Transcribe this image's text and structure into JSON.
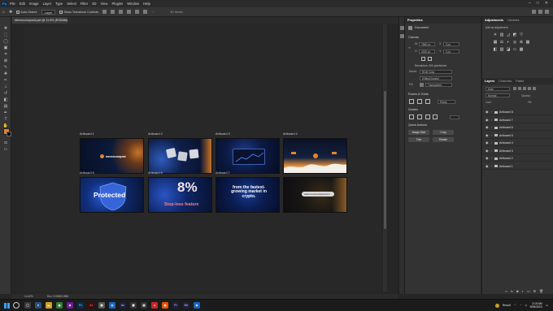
{
  "menu": {
    "logo": "Ps",
    "items": [
      "File",
      "Edit",
      "Image",
      "Layer",
      "Type",
      "Select",
      "Filter",
      "3D",
      "View",
      "Plugins",
      "Window",
      "Help"
    ]
  },
  "options_bar": {
    "auto_select_label": "Auto-Select:",
    "auto_select_value": "Layer",
    "transform_label": "Show Transform Controls",
    "mode_3d": "3D Mode:"
  },
  "document": {
    "tab_title": "Mexexcomposit.psd @ 11.6% (RGB/8#)",
    "zoom": "11.62%",
    "size_info": "Doc: 9.00M/3.55M"
  },
  "artboards": [
    {
      "label": "Artboard 1",
      "caption": "mexexcompost"
    },
    {
      "label": "Artboard 2",
      "caption": ""
    },
    {
      "label": "Artboard 3",
      "caption": ""
    },
    {
      "label": "Artboard 4",
      "caption": ""
    },
    {
      "label": "Artboard 5",
      "caption": "Protected"
    },
    {
      "label": "Artboard 6",
      "big": "8%",
      "caption": "Stop-loss feature"
    },
    {
      "label": "Artboard 7",
      "caption": "from the fastest-growing market in crypto."
    },
    {
      "label": "Artboard 8",
      "caption": "www.mexexcompost.com"
    }
  ],
  "properties": {
    "tabs": [
      "Properties",
      "Libraries"
    ],
    "doc_label": "Document",
    "canvas_section": "Canvas",
    "width_label": "W",
    "width_value": "7680 px",
    "height_label": "H",
    "height_value": "4320 px",
    "x_label": "X",
    "x_value": "0 px",
    "y_label": "Y",
    "y_value": "0 px",
    "resolution": "Resolution: 300 pixels/inch",
    "mode_label": "Mode",
    "mode_value": "RGB Color",
    "depth_value": "8 Bits/Channel",
    "fill_label": "Fill",
    "fill_value": "Transparent",
    "rulers_section": "Rulers & Grids",
    "rulers_unit": "Pixels",
    "guides_section": "Guides",
    "quick_actions_section": "Quick Actions",
    "quick_actions": [
      "Image Size",
      "Crop",
      "Trim",
      "Rotate"
    ]
  },
  "adjustments": {
    "tabs": [
      "Adjustments",
      "Libraries"
    ],
    "subtitle": "Add an adjustment"
  },
  "layers": {
    "tabs": [
      "Layers",
      "Channels",
      "Paths"
    ],
    "kind_label": "Kind",
    "blend_mode": "Normal",
    "opacity_label": "Opacity:",
    "lock_label": "Lock:",
    "fill_label": "Fill:",
    "items": [
      "Artboard 8",
      "Artboard 7",
      "Artboard 6",
      "Artboard 5",
      "Artboard 4",
      "Artboard 3",
      "Artboard 2",
      "Artboard 1"
    ]
  },
  "taskbar": {
    "tray_label": "Result",
    "time": "2:15 AM",
    "date": "9/28/2023"
  },
  "colors": {
    "foreground": "#e5822e",
    "background": "#111111",
    "accent": "#31a8ff"
  }
}
